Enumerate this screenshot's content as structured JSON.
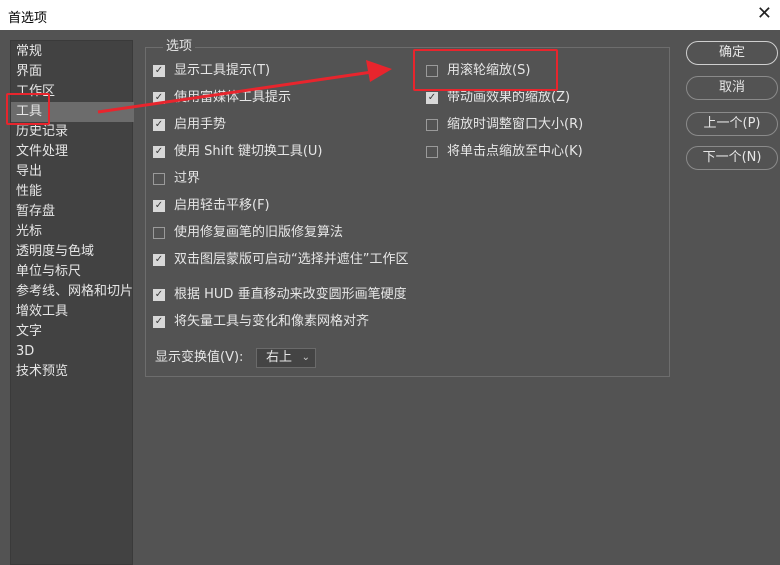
{
  "window": {
    "title": "首选项",
    "close_glyph": "✕"
  },
  "sidebar": {
    "items": [
      {
        "label": "常规"
      },
      {
        "label": "界面"
      },
      {
        "label": "工作区"
      },
      {
        "label": "工具",
        "selected": true
      },
      {
        "label": "历史记录"
      },
      {
        "label": "文件处理"
      },
      {
        "label": "导出"
      },
      {
        "label": "性能"
      },
      {
        "label": "暂存盘"
      },
      {
        "label": "光标"
      },
      {
        "label": "透明度与色域"
      },
      {
        "label": "单位与标尺"
      },
      {
        "label": "参考线、网格和切片"
      },
      {
        "label": "增效工具"
      },
      {
        "label": "文字"
      },
      {
        "label": "3D"
      },
      {
        "label": "技术预览"
      }
    ]
  },
  "options": {
    "group_title": "选项",
    "left": [
      {
        "label": "显示工具提示(T)",
        "checked": true
      },
      {
        "label": "使用富媒体工具提示",
        "checked": true
      },
      {
        "label": "启用手势",
        "checked": true
      },
      {
        "label": "使用 Shift 键切换工具(U)",
        "checked": true
      },
      {
        "label": "过界",
        "checked": false
      },
      {
        "label": "启用轻击平移(F)",
        "checked": true
      },
      {
        "label": "使用修复画笔的旧版修复算法",
        "checked": false
      },
      {
        "label": "双击图层蒙版可启动“选择并遮住”工作区",
        "checked": true
      },
      {
        "label": "根据 HUD 垂直移动来改变圆形画笔硬度",
        "checked": true
      },
      {
        "label": "将矢量工具与变化和像素网格对齐",
        "checked": true
      }
    ],
    "right": [
      {
        "label": "用滚轮缩放(S)",
        "checked": false
      },
      {
        "label": "带动画效果的缩放(Z)",
        "checked": true
      },
      {
        "label": "缩放时调整窗口大小(R)",
        "checked": false
      },
      {
        "label": "将单击点缩放至中心(K)",
        "checked": false
      }
    ],
    "transform_label": "显示变换值(V):",
    "transform_value": "右上"
  },
  "buttons": {
    "ok": "确定",
    "cancel": "取消",
    "prev": "上一个(P)",
    "next": "下一个(N)"
  },
  "annotation_color": "#e8252d"
}
